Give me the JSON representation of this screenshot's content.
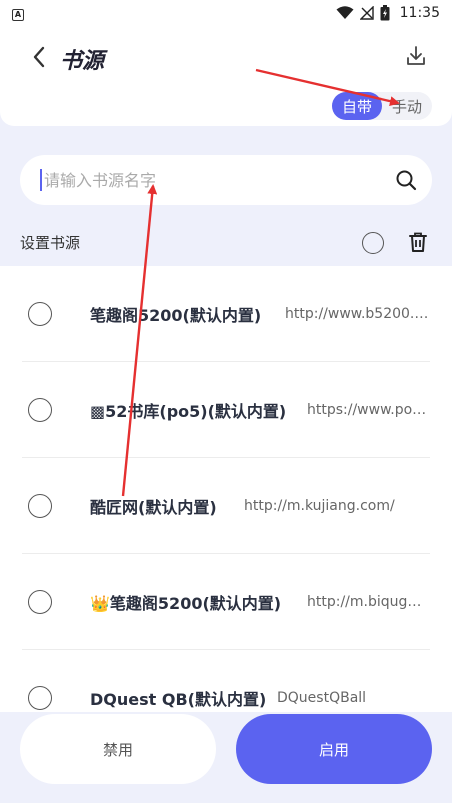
{
  "status_bar": {
    "app_badge": "A",
    "time": "11:35",
    "icons": [
      "wifi-icon",
      "signal-off-icon",
      "battery-charging-icon"
    ]
  },
  "header": {
    "title": "书源",
    "back_icon": "chevron-left-icon",
    "download_icon": "download-icon",
    "mode_toggle": {
      "auto_label": "自带",
      "manual_label": "手动",
      "selected": "auto"
    }
  },
  "search": {
    "placeholder": "请输入书源名字",
    "value": "",
    "icon": "search-icon"
  },
  "settings": {
    "label": "设置书源",
    "select_all_icon": "radio-icon",
    "delete_icon": "trash-icon"
  },
  "sources": [
    {
      "name": "笔趣阁5200(默认内置)",
      "url": "http://www.b5200.o..."
    },
    {
      "name": "▩52书库(po5)(默认内置)",
      "url": "https://www.po5..."
    },
    {
      "name": "酷匠网(默认内置)",
      "url": "http://m.kujiang.com/"
    },
    {
      "name": "👑笔趣阁5200(默认内置)",
      "url": "http://m.biquge5..."
    },
    {
      "name": "DQuest QB(默认内置)",
      "url": "DQuestQBall"
    }
  ],
  "actions": {
    "disable_label": "禁用",
    "enable_label": "启用"
  },
  "colors": {
    "accent": "#5b63f0",
    "annotation": "#e53030",
    "background": "#eef0fb"
  }
}
